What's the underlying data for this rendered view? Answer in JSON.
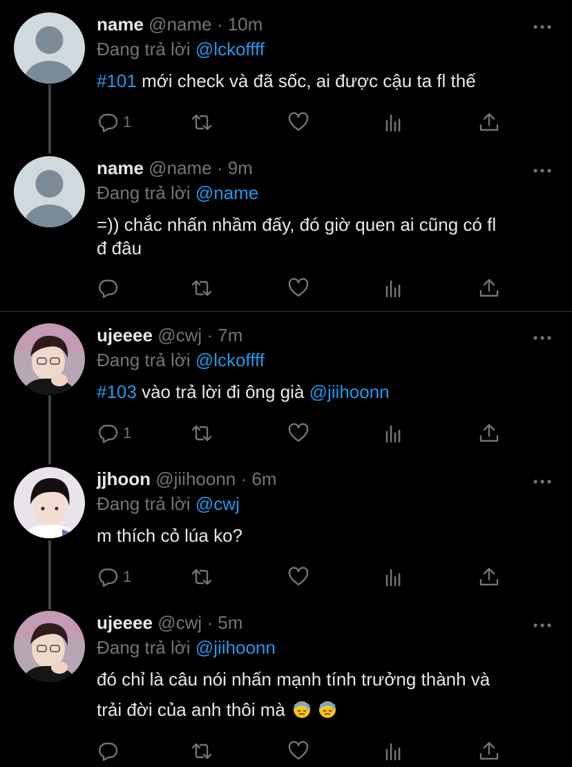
{
  "tweets": [
    {
      "name": "name",
      "handle": "@name",
      "time": "10m",
      "replying_label": "Đang trả lời",
      "replying_to": "@lckoffff",
      "hashtag": "#101",
      "text": " mới check và đã sốc, ai được cậu ta fl thế",
      "reply_count": "1"
    },
    {
      "name": "name",
      "handle": "@name",
      "time": "9m",
      "replying_label": "Đang trả lời",
      "replying_to": "@name",
      "text_line1": "=)) chắc nhấn nhầm đấy, đó giờ quen ai cũng có fl",
      "text_line2": "đ  đâu",
      "reply_count": ""
    },
    {
      "name": "ujeeee",
      "handle": "@cwj",
      "time": "7m",
      "replying_label": "Đang trả lời",
      "replying_to": "@lckoffff",
      "hashtag": "#103",
      "text": " vào trả lời đi ông già ",
      "mention": "@jiihoonn",
      "reply_count": "1"
    },
    {
      "name": "jjhoon",
      "handle": "@jiihoonn",
      "time": "6m",
      "replying_label": "Đang trả lời",
      "replying_to": "@cwj",
      "text": "m thích cỏ lúa ko?",
      "reply_count": "1"
    },
    {
      "name": "ujeeee",
      "handle": "@cwj",
      "time": "5m",
      "replying_label": "Đang trả lời",
      "replying_to": "@jiihoonn",
      "text_line1": "đó chỉ là câu nói nhấn mạnh tính trưởng thành và",
      "text_line2": "trải đời của anh thôi mà",
      "reply_count": ""
    }
  ],
  "separator": " · ",
  "icons": [
    "reply-icon",
    "retweet-icon",
    "like-icon",
    "analytics-icon",
    "share-icon",
    "more-icon",
    "downcast-sweat-emoji"
  ],
  "colors": {
    "background": "#000000",
    "text": "#e7e9ea",
    "muted": "#71767b",
    "accent": "#1d9bf0",
    "thread_line": "#3e4144"
  }
}
